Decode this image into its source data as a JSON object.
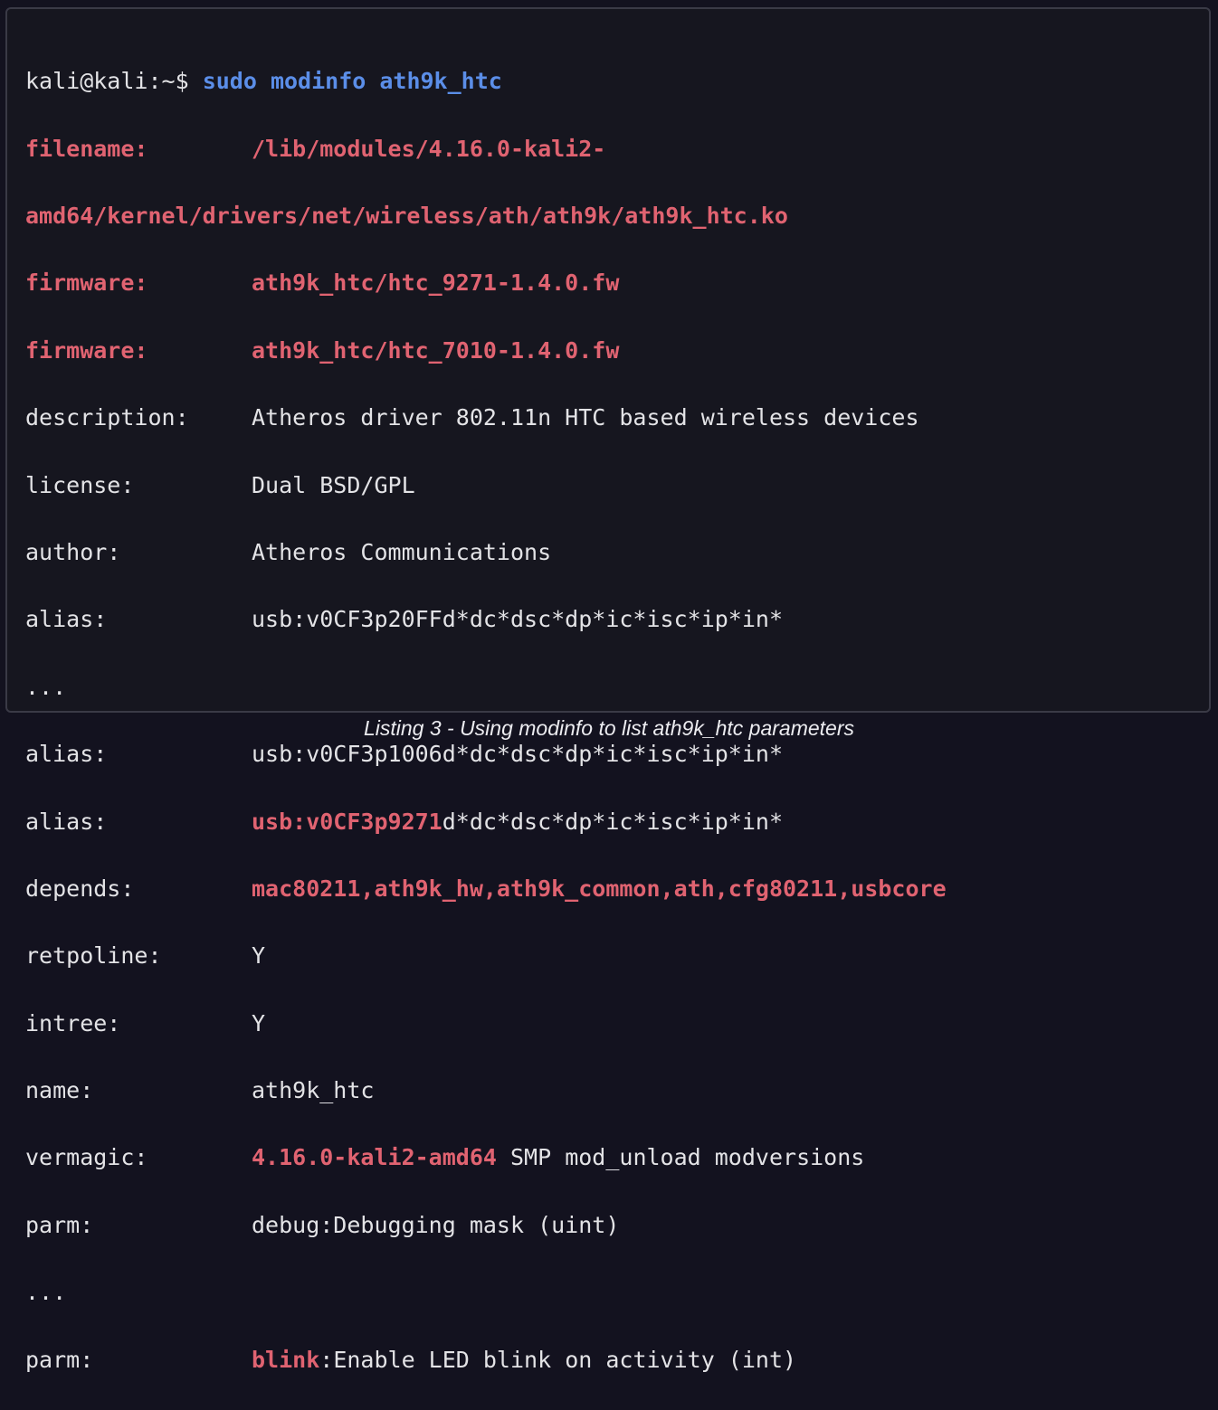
{
  "terminal": {
    "prompt": "kali@kali:~$",
    "command": "sudo modinfo ath9k_htc",
    "filename": {
      "key": "filename:",
      "value_part1": "/lib/modules/4.16.0-kali2-",
      "value_part2": "amd64/kernel/drivers/net/wireless/ath/ath9k/ath9k_htc.ko"
    },
    "firmware1": {
      "key": "firmware:",
      "value": "ath9k_htc/htc_9271-1.4.0.fw"
    },
    "firmware2": {
      "key": "firmware:",
      "value": "ath9k_htc/htc_7010-1.4.0.fw"
    },
    "description": {
      "key": "description:",
      "value": "Atheros driver 802.11n HTC based wireless devices"
    },
    "license": {
      "key": "license:",
      "value": "Dual BSD/GPL"
    },
    "author": {
      "key": "author:",
      "value": "Atheros Communications"
    },
    "alias1": {
      "key": "alias:",
      "value": "usb:v0CF3p20FFd*dc*dsc*dp*ic*isc*ip*in*"
    },
    "ellipsis1": "...",
    "alias2": {
      "key": "alias:",
      "value": "usb:v0CF3p1006d*dc*dsc*dp*ic*isc*ip*in*"
    },
    "alias3": {
      "key": "alias:",
      "value_highlight": "usb:v0CF3p9271",
      "value_rest": "d*dc*dsc*dp*ic*isc*ip*in*"
    },
    "depends": {
      "key": "depends:",
      "value": "mac80211,ath9k_hw,ath9k_common,ath,cfg80211,usbcore"
    },
    "retpoline": {
      "key": "retpoline:",
      "value": "Y"
    },
    "intree": {
      "key": "intree:",
      "value": "Y"
    },
    "name": {
      "key": "name:",
      "value": "ath9k_htc"
    },
    "vermagic": {
      "key": "vermagic:",
      "value_highlight": "4.16.0-kali2-amd64",
      "value_rest": " SMP mod_unload modversions"
    },
    "parm1": {
      "key": "parm:",
      "value": "debug:Debugging mask (uint)"
    },
    "ellipsis2": "...",
    "parm2": {
      "key": "parm:",
      "value_highlight": "blink",
      "value_rest": ":Enable LED blink on activity (int)"
    }
  },
  "caption": "Listing 3 - Using modinfo to list ath9k_htc parameters",
  "colors": {
    "background": "#16161f",
    "text": "#e3e3e6",
    "highlight_red": "#e06371",
    "command_blue": "#5b8ee8"
  }
}
